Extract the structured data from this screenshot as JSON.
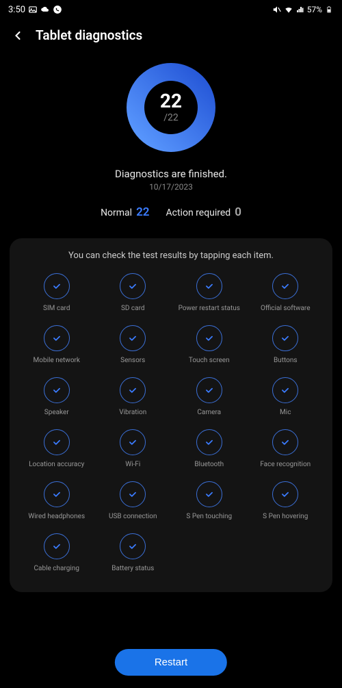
{
  "statusBar": {
    "time": "3:50",
    "batteryText": "57%"
  },
  "header": {
    "title": "Tablet diagnostics"
  },
  "progress": {
    "count": "22",
    "total": "/22"
  },
  "finished": {
    "title": "Diagnostics are finished.",
    "date": "10/17/2023"
  },
  "counts": {
    "normalLabel": "Normal",
    "normalValue": "22",
    "actionLabel": "Action required",
    "actionValue": "0"
  },
  "results": {
    "hint": "You can check the test results by tapping each item.",
    "items": [
      {
        "label": "SIM card"
      },
      {
        "label": "SD card"
      },
      {
        "label": "Power restart status"
      },
      {
        "label": "Official software"
      },
      {
        "label": "Mobile network"
      },
      {
        "label": "Sensors"
      },
      {
        "label": "Touch screen"
      },
      {
        "label": "Buttons"
      },
      {
        "label": "Speaker"
      },
      {
        "label": "Vibration"
      },
      {
        "label": "Camera"
      },
      {
        "label": "Mic"
      },
      {
        "label": "Location accuracy"
      },
      {
        "label": "Wi-Fi"
      },
      {
        "label": "Bluetooth"
      },
      {
        "label": "Face recognition"
      },
      {
        "label": "Wired headphones"
      },
      {
        "label": "USB connection"
      },
      {
        "label": "S Pen touching"
      },
      {
        "label": "S Pen hovering"
      },
      {
        "label": "Cable charging"
      },
      {
        "label": "Battery status"
      }
    ]
  },
  "restart": {
    "label": "Restart"
  }
}
